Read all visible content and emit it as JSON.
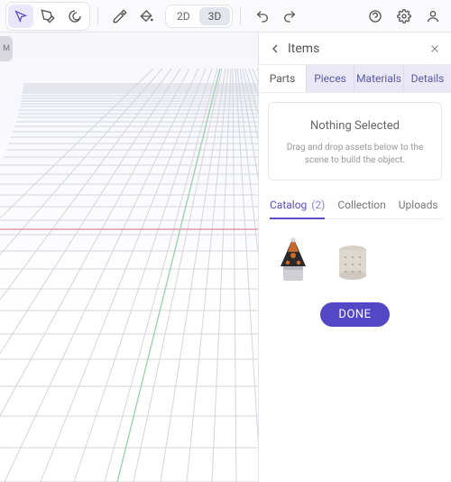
{
  "toolbar": {
    "view2d": "2D",
    "view3d": "3D"
  },
  "left_handle": "M",
  "panel": {
    "title": "Items",
    "tabs": {
      "parts": "Parts",
      "pieces": "Pieces",
      "materials": "Materials",
      "details": "Details"
    },
    "nothing_heading": "Nothing Selected",
    "nothing_sub": "Drag and drop assets below to the scene to build the object.",
    "sub_tabs": {
      "catalog_label": "Catalog",
      "catalog_count": "(2)",
      "collection": "Collection",
      "uploads": "Uploads"
    },
    "done": "DONE"
  }
}
